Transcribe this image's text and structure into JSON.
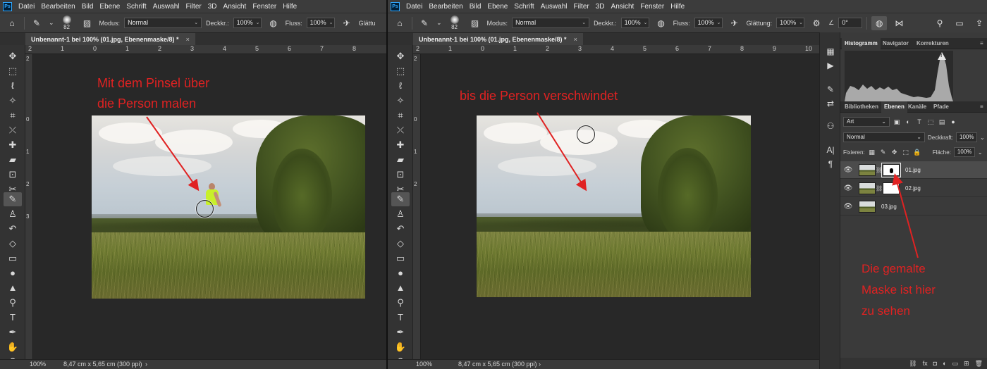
{
  "app": {
    "logo": "Ps",
    "menu": [
      "Datei",
      "Bearbeiten",
      "Bild",
      "Ebene",
      "Schrift",
      "Auswahl",
      "Filter",
      "3D",
      "Ansicht",
      "Fenster",
      "Hilfe"
    ]
  },
  "options_bar": {
    "brush_size": "82",
    "mode_label": "Modus:",
    "mode_value": "Normal",
    "opacity_label": "Deckkr.:",
    "opacity_value": "100%",
    "flow_label": "Fluss:",
    "flow_value": "100%",
    "smoothing_label_cut": "Glättu",
    "smoothing_label": "Glättung:",
    "smoothing_value": "100%",
    "angle_value": "0°"
  },
  "left_window": {
    "doc_tab": "Unbenannt-1 bei 100% (01.jpg, Ebenenmaske/8) *",
    "ruler_top": [
      "2",
      "1",
      "0",
      "1",
      "2",
      "3",
      "4",
      "5",
      "6",
      "7",
      "8"
    ],
    "ruler_left": [
      "2",
      "0",
      "1",
      "2",
      "3"
    ],
    "zoom": "100%",
    "doc_info": "8,47 cm x 5,65 cm (300 ppi)",
    "annotation_line1": "Mit dem Pinsel über",
    "annotation_line2": "die Person malen"
  },
  "right_window": {
    "doc_tab": "Unbenannt-1 bei 100% (01.jpg, Ebenenmaske/8) *",
    "ruler_top": [
      "2",
      "1",
      "0",
      "1",
      "2",
      "3",
      "4",
      "5",
      "6",
      "7",
      "8",
      "9",
      "10"
    ],
    "ruler_left": [
      "2",
      "0",
      "1",
      "2"
    ],
    "zoom": "100%",
    "doc_info": "8,47 cm x 5,65 cm (300 ppi)",
    "annotation": "bis die Person verschwindet",
    "annotation_mask_1": "Die gemalte",
    "annotation_mask_2": "Maske ist hier",
    "annotation_mask_3": "zu sehen"
  },
  "histogram_panel": {
    "tabs": [
      "Histogramm",
      "Navigator",
      "Korrekturen"
    ]
  },
  "layers_panel": {
    "tabs": [
      "Bibliotheken",
      "Ebenen",
      "Kanäle",
      "Pfade"
    ],
    "filter_value": "Art",
    "blend_mode": "Normal",
    "opacity_label": "Deckkraft:",
    "opacity_value": "100%",
    "lock_label": "Fixieren:",
    "fill_label": "Fläche:",
    "fill_value": "100%",
    "layers": [
      {
        "name": "01.jpg",
        "has_mask": true,
        "selected": true
      },
      {
        "name": "02.jpg",
        "has_mask": true,
        "selected": false
      },
      {
        "name": "03.jpg",
        "has_mask": false,
        "selected": false
      }
    ],
    "footer_fx": "fx"
  },
  "colors": {
    "annotation_red": "#e02222",
    "highlight_yellow": "#c8f02a"
  }
}
